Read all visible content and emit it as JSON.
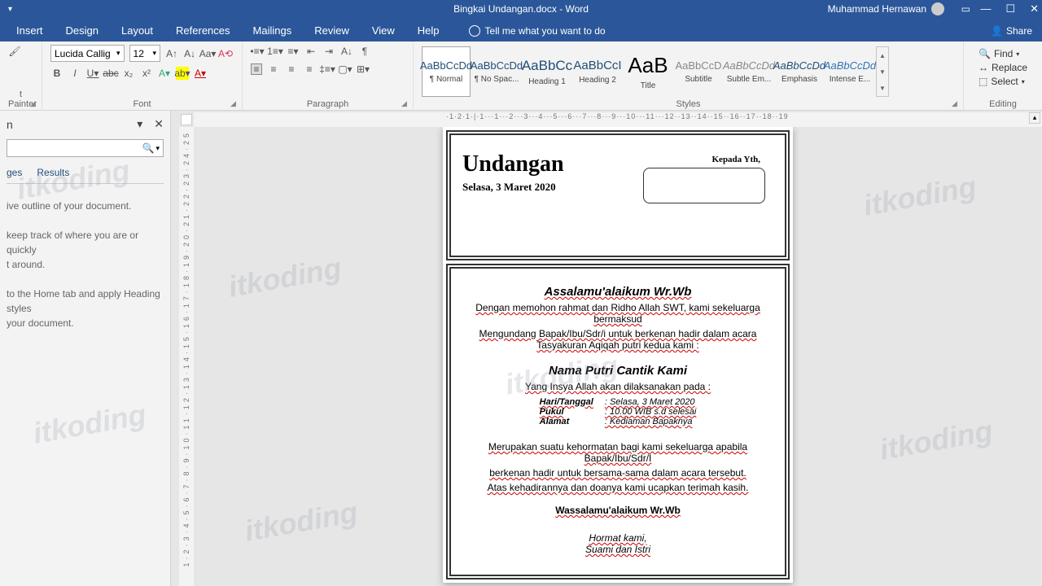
{
  "titlebar": {
    "filename": "Bingkai Undangan.docx  -  Word",
    "username": "Muhammad Hernawan"
  },
  "tabs": {
    "insert": "Insert",
    "design": "Design",
    "layout": "Layout",
    "references": "References",
    "mailings": "Mailings",
    "review": "Review",
    "view": "View",
    "help": "Help",
    "tellme": "Tell me what you want to do",
    "share": "Share"
  },
  "font": {
    "name": "Lucida Callig",
    "size": "12",
    "group_label": "Font",
    "painter": "t Painter"
  },
  "paragraph": {
    "group_label": "Paragraph"
  },
  "styles": {
    "group_label": "Styles",
    "items": [
      {
        "preview": "AaBbCcDd",
        "name": "¶ Normal"
      },
      {
        "preview": "AaBbCcDd",
        "name": "¶ No Spac..."
      },
      {
        "preview": "AaBbCc",
        "name": "Heading 1"
      },
      {
        "preview": "AaBbCcI",
        "name": "Heading 2"
      },
      {
        "preview": "AaB",
        "name": "Title"
      },
      {
        "preview": "AaBbCcD",
        "name": "Subtitle"
      },
      {
        "preview": "AaBbCcDd",
        "name": "Subtle Em..."
      },
      {
        "preview": "AaBbCcDd",
        "name": "Emphasis"
      },
      {
        "preview": "AaBbCcDd",
        "name": "Intense E..."
      }
    ]
  },
  "editing": {
    "group_label": "Editing",
    "find": "Find",
    "replace": "Replace",
    "select": "Select"
  },
  "nav": {
    "tabs": {
      "pages": "ges",
      "results": "Results"
    },
    "line1": "ive outline of your document.",
    "line2": "keep track of where you are or quickly",
    "line3": "t around.",
    "line4": "to the Home tab and apply Heading styles",
    "line5": "your document."
  },
  "ruler": "·1·2·1·|·1···1···2···3···4···5···6···7···8···9···10···11···12··13··14··15··16··17··18··19",
  "doc": {
    "title": "Undangan",
    "date": "Selasa, 3 Maret 2020",
    "kepada": "Kepada Yth,",
    "salam": "Assalamu'alaikum Wr.Wb",
    "p1": "Dengan memohon rahmat dan Ridho Allah SWT, kami sekeluarga bermaksud",
    "p2": "Mengundang Bapak/Ibu/Sdr/i untuk berkenan hadir dalam acara",
    "p3": "Tasyakuran Aqiqah putri kedua kami :",
    "name": "Nama Putri Cantik Kami",
    "p4": "Yang Insya Allah akan dilaksanakan  pada :",
    "hari_l": "Hari/Tanggal",
    "hari_v": ": Selasa, 3 Maret 2020",
    "pukul_l": "Pukul",
    "pukul_v": ": 10.00 WIB s.d selesai",
    "alamat_l": "Alamat",
    "alamat_v": ": Kediaman Bapaknya",
    "p5": "Merupakan suatu kehormatan bagi kami sekeluarga apabila Bapak/Ibu/Sdr/I",
    "p6": "berkenan hadir untuk bersama-sama dalam acara tersebut.",
    "p7": "Atas kehadirannya dan doanya kami ucapkan terimah kasih.",
    "wassalam": "Wassalamu'alaikum Wr.Wb",
    "hormat": "Hormat kami,",
    "sign": "Suami dan Istri"
  },
  "watermark": "itkoding"
}
